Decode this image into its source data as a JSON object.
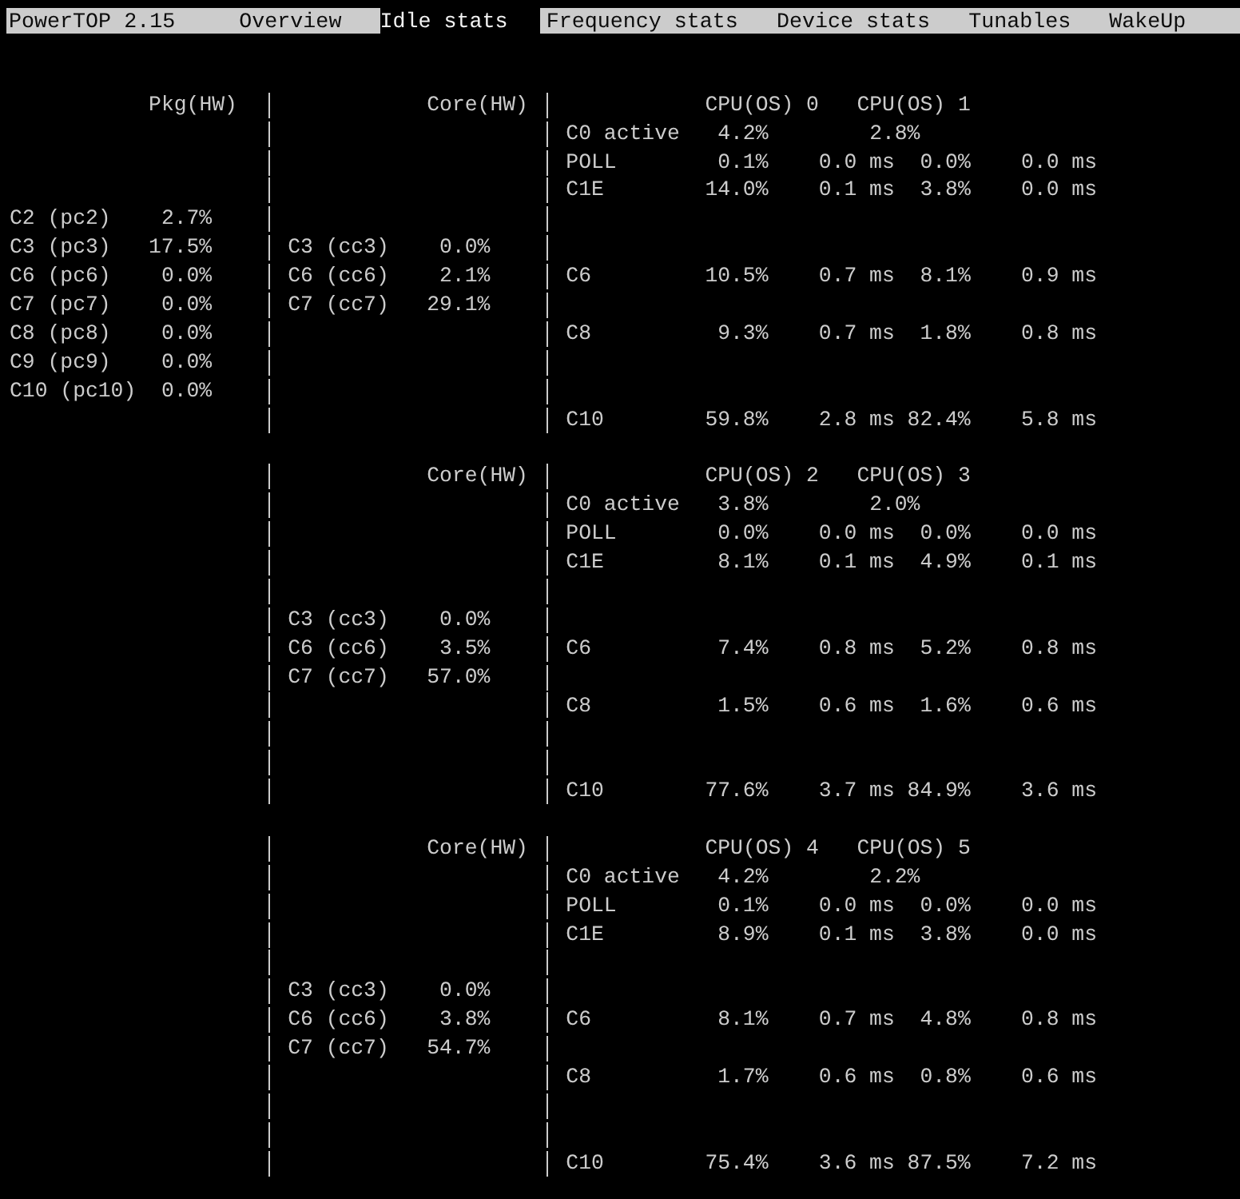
{
  "app": {
    "title": "PowerTOP 2.15"
  },
  "tabs": [
    {
      "label": "Overview",
      "selected": false
    },
    {
      "label": "Idle stats",
      "selected": true
    },
    {
      "label": "Frequency stats",
      "selected": false
    },
    {
      "label": "Device stats",
      "selected": false
    },
    {
      "label": "Tunables",
      "selected": false
    },
    {
      "label": "WakeUp",
      "selected": false
    }
  ],
  "blocks": [
    {
      "package_heading": "Pkg(HW)",
      "core_heading": "Core(HW)",
      "cpu_headings": [
        "CPU(OS) 0",
        "CPU(OS) 1"
      ],
      "lines": [
        {
          "kind": "states",
          "cpu": {
            "state": "C0 active",
            "cpu_a": "4.2%",
            "cpu_b": "2.8%"
          }
        },
        {
          "kind": "states",
          "cpu": {
            "state": "POLL",
            "cpu_a": "0.1%",
            "cpu_a_time": "0.0 ms",
            "cpu_b": "0.0%",
            "cpu_b_time": "0.0 ms"
          }
        },
        {
          "kind": "states",
          "cpu": {
            "state": "C1E",
            "cpu_a": "14.0%",
            "cpu_a_time": "0.1 ms",
            "cpu_b": "3.8%",
            "cpu_b_time": "0.0 ms"
          }
        },
        {
          "kind": "states",
          "package": {
            "state": "C2 (pc2)",
            "value": "2.7%"
          }
        },
        {
          "kind": "states",
          "package": {
            "state": "C3 (pc3)",
            "value": "17.5%"
          },
          "core": {
            "state": "C3 (cc3)",
            "value": "0.0%"
          }
        },
        {
          "kind": "states",
          "package": {
            "state": "C6 (pc6)",
            "value": "0.0%"
          },
          "core": {
            "state": "C6 (cc6)",
            "value": "2.1%"
          },
          "cpu": {
            "state": "C6",
            "cpu_a": "10.5%",
            "cpu_a_time": "0.7 ms",
            "cpu_b": "8.1%",
            "cpu_b_time": "0.9 ms"
          }
        },
        {
          "kind": "states",
          "package": {
            "state": "C7 (pc7)",
            "value": "0.0%"
          },
          "core": {
            "state": "C7 (cc7)",
            "value": "29.1%"
          }
        },
        {
          "kind": "states",
          "package": {
            "state": "C8 (pc8)",
            "value": "0.0%"
          },
          "cpu": {
            "state": "C8",
            "cpu_a": "9.3%",
            "cpu_a_time": "0.7 ms",
            "cpu_b": "1.8%",
            "cpu_b_time": "0.8 ms"
          }
        },
        {
          "kind": "states",
          "package": {
            "state": "C9 (pc9)",
            "value": "0.0%"
          }
        },
        {
          "kind": "states",
          "package": {
            "state": "C10 (pc10)",
            "value": "0.0%"
          }
        },
        {
          "kind": "states",
          "cpu": {
            "state": "C10",
            "cpu_a": "59.8%",
            "cpu_a_time": "2.8 ms",
            "cpu_b": "82.4%",
            "cpu_b_time": "5.8 ms"
          }
        }
      ]
    },
    {
      "core_heading": "Core(HW)",
      "cpu_headings": [
        "CPU(OS) 2",
        "CPU(OS) 3"
      ],
      "lines": [
        {
          "kind": "states",
          "cpu": {
            "state": "C0 active",
            "cpu_a": "3.8%",
            "cpu_b": "2.0%"
          }
        },
        {
          "kind": "states",
          "cpu": {
            "state": "POLL",
            "cpu_a": "0.0%",
            "cpu_a_time": "0.0 ms",
            "cpu_b": "0.0%",
            "cpu_b_time": "0.0 ms"
          }
        },
        {
          "kind": "states",
          "cpu": {
            "state": "C1E",
            "cpu_a": "8.1%",
            "cpu_a_time": "0.1 ms",
            "cpu_b": "4.9%",
            "cpu_b_time": "0.1 ms"
          }
        },
        {
          "kind": "blank"
        },
        {
          "kind": "states",
          "core": {
            "state": "C3 (cc3)",
            "value": "0.0%"
          }
        },
        {
          "kind": "states",
          "core": {
            "state": "C6 (cc6)",
            "value": "3.5%"
          },
          "cpu": {
            "state": "C6",
            "cpu_a": "7.4%",
            "cpu_a_time": "0.8 ms",
            "cpu_b": "5.2%",
            "cpu_b_time": "0.8 ms"
          }
        },
        {
          "kind": "states",
          "core": {
            "state": "C7 (cc7)",
            "value": "57.0%"
          }
        },
        {
          "kind": "states",
          "cpu": {
            "state": "C8",
            "cpu_a": "1.5%",
            "cpu_a_time": "0.6 ms",
            "cpu_b": "1.6%",
            "cpu_b_time": "0.6 ms"
          }
        },
        {
          "kind": "blank"
        },
        {
          "kind": "blank"
        },
        {
          "kind": "states",
          "cpu": {
            "state": "C10",
            "cpu_a": "77.6%",
            "cpu_a_time": "3.7 ms",
            "cpu_b": "84.9%",
            "cpu_b_time": "3.6 ms"
          }
        }
      ]
    },
    {
      "core_heading": "Core(HW)",
      "cpu_headings": [
        "CPU(OS) 4",
        "CPU(OS) 5"
      ],
      "lines": [
        {
          "kind": "states",
          "cpu": {
            "state": "C0 active",
            "cpu_a": "4.2%",
            "cpu_b": "2.2%"
          }
        },
        {
          "kind": "states",
          "cpu": {
            "state": "POLL",
            "cpu_a": "0.1%",
            "cpu_a_time": "0.0 ms",
            "cpu_b": "0.0%",
            "cpu_b_time": "0.0 ms"
          }
        },
        {
          "kind": "states",
          "cpu": {
            "state": "C1E",
            "cpu_a": "8.9%",
            "cpu_a_time": "0.1 ms",
            "cpu_b": "3.8%",
            "cpu_b_time": "0.0 ms"
          }
        },
        {
          "kind": "blank"
        },
        {
          "kind": "states",
          "core": {
            "state": "C3 (cc3)",
            "value": "0.0%"
          }
        },
        {
          "kind": "states",
          "core": {
            "state": "C6 (cc6)",
            "value": "3.8%"
          },
          "cpu": {
            "state": "C6",
            "cpu_a": "8.1%",
            "cpu_a_time": "0.7 ms",
            "cpu_b": "4.8%",
            "cpu_b_time": "0.8 ms"
          }
        },
        {
          "kind": "states",
          "core": {
            "state": "C7 (cc7)",
            "value": "54.7%"
          }
        },
        {
          "kind": "states",
          "cpu": {
            "state": "C8",
            "cpu_a": "1.7%",
            "cpu_a_time": "0.6 ms",
            "cpu_b": "0.8%",
            "cpu_b_time": "0.6 ms"
          }
        },
        {
          "kind": "blank"
        },
        {
          "kind": "blank"
        },
        {
          "kind": "states",
          "cpu": {
            "state": "C10",
            "cpu_a": "75.4%",
            "cpu_a_time": "3.6 ms",
            "cpu_b": "87.5%",
            "cpu_b_time": "7.2 ms"
          }
        }
      ]
    }
  ]
}
